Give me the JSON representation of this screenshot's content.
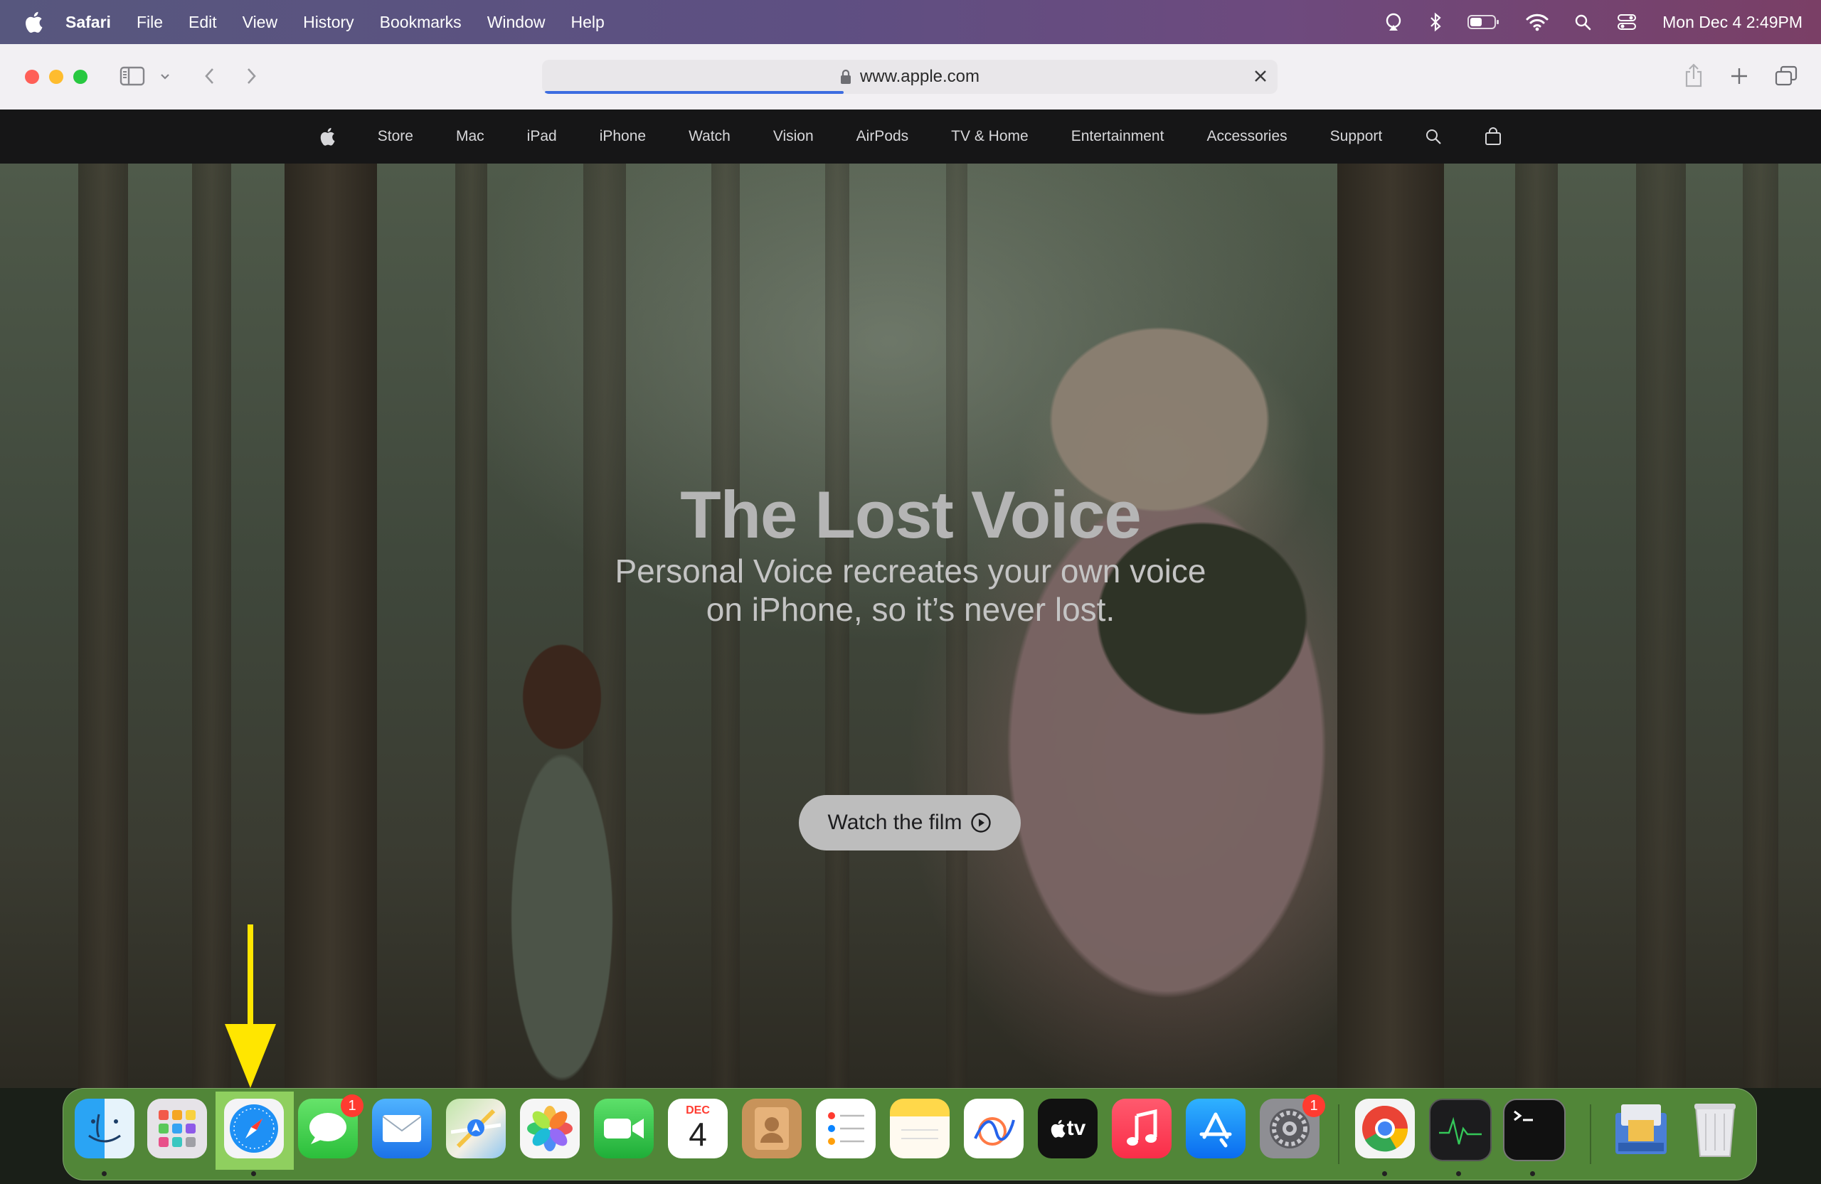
{
  "menubar": {
    "app_name": "Safari",
    "items": [
      "File",
      "Edit",
      "View",
      "History",
      "Bookmarks",
      "Window",
      "Help"
    ],
    "datetime": "Mon Dec 4  2:49PM"
  },
  "browser": {
    "url": "www.apple.com"
  },
  "apple_nav": {
    "items": [
      "Store",
      "Mac",
      "iPad",
      "iPhone",
      "Watch",
      "Vision",
      "AirPods",
      "TV & Home",
      "Entertainment",
      "Accessories",
      "Support"
    ]
  },
  "hero": {
    "title": "The Lost Voice",
    "subtitle_line1": "Personal Voice recreates your own voice",
    "subtitle_line2": "on iPhone, so it’s never lost.",
    "cta_label": "Watch the film"
  },
  "dock": {
    "messages_badge": "1",
    "settings_badge": "1",
    "calendar_month": "DEC",
    "calendar_day": "4",
    "tv_label": "tv"
  },
  "annotation": {
    "arrow_color": "#ffe600",
    "highlight_color": "#8acd5a"
  }
}
